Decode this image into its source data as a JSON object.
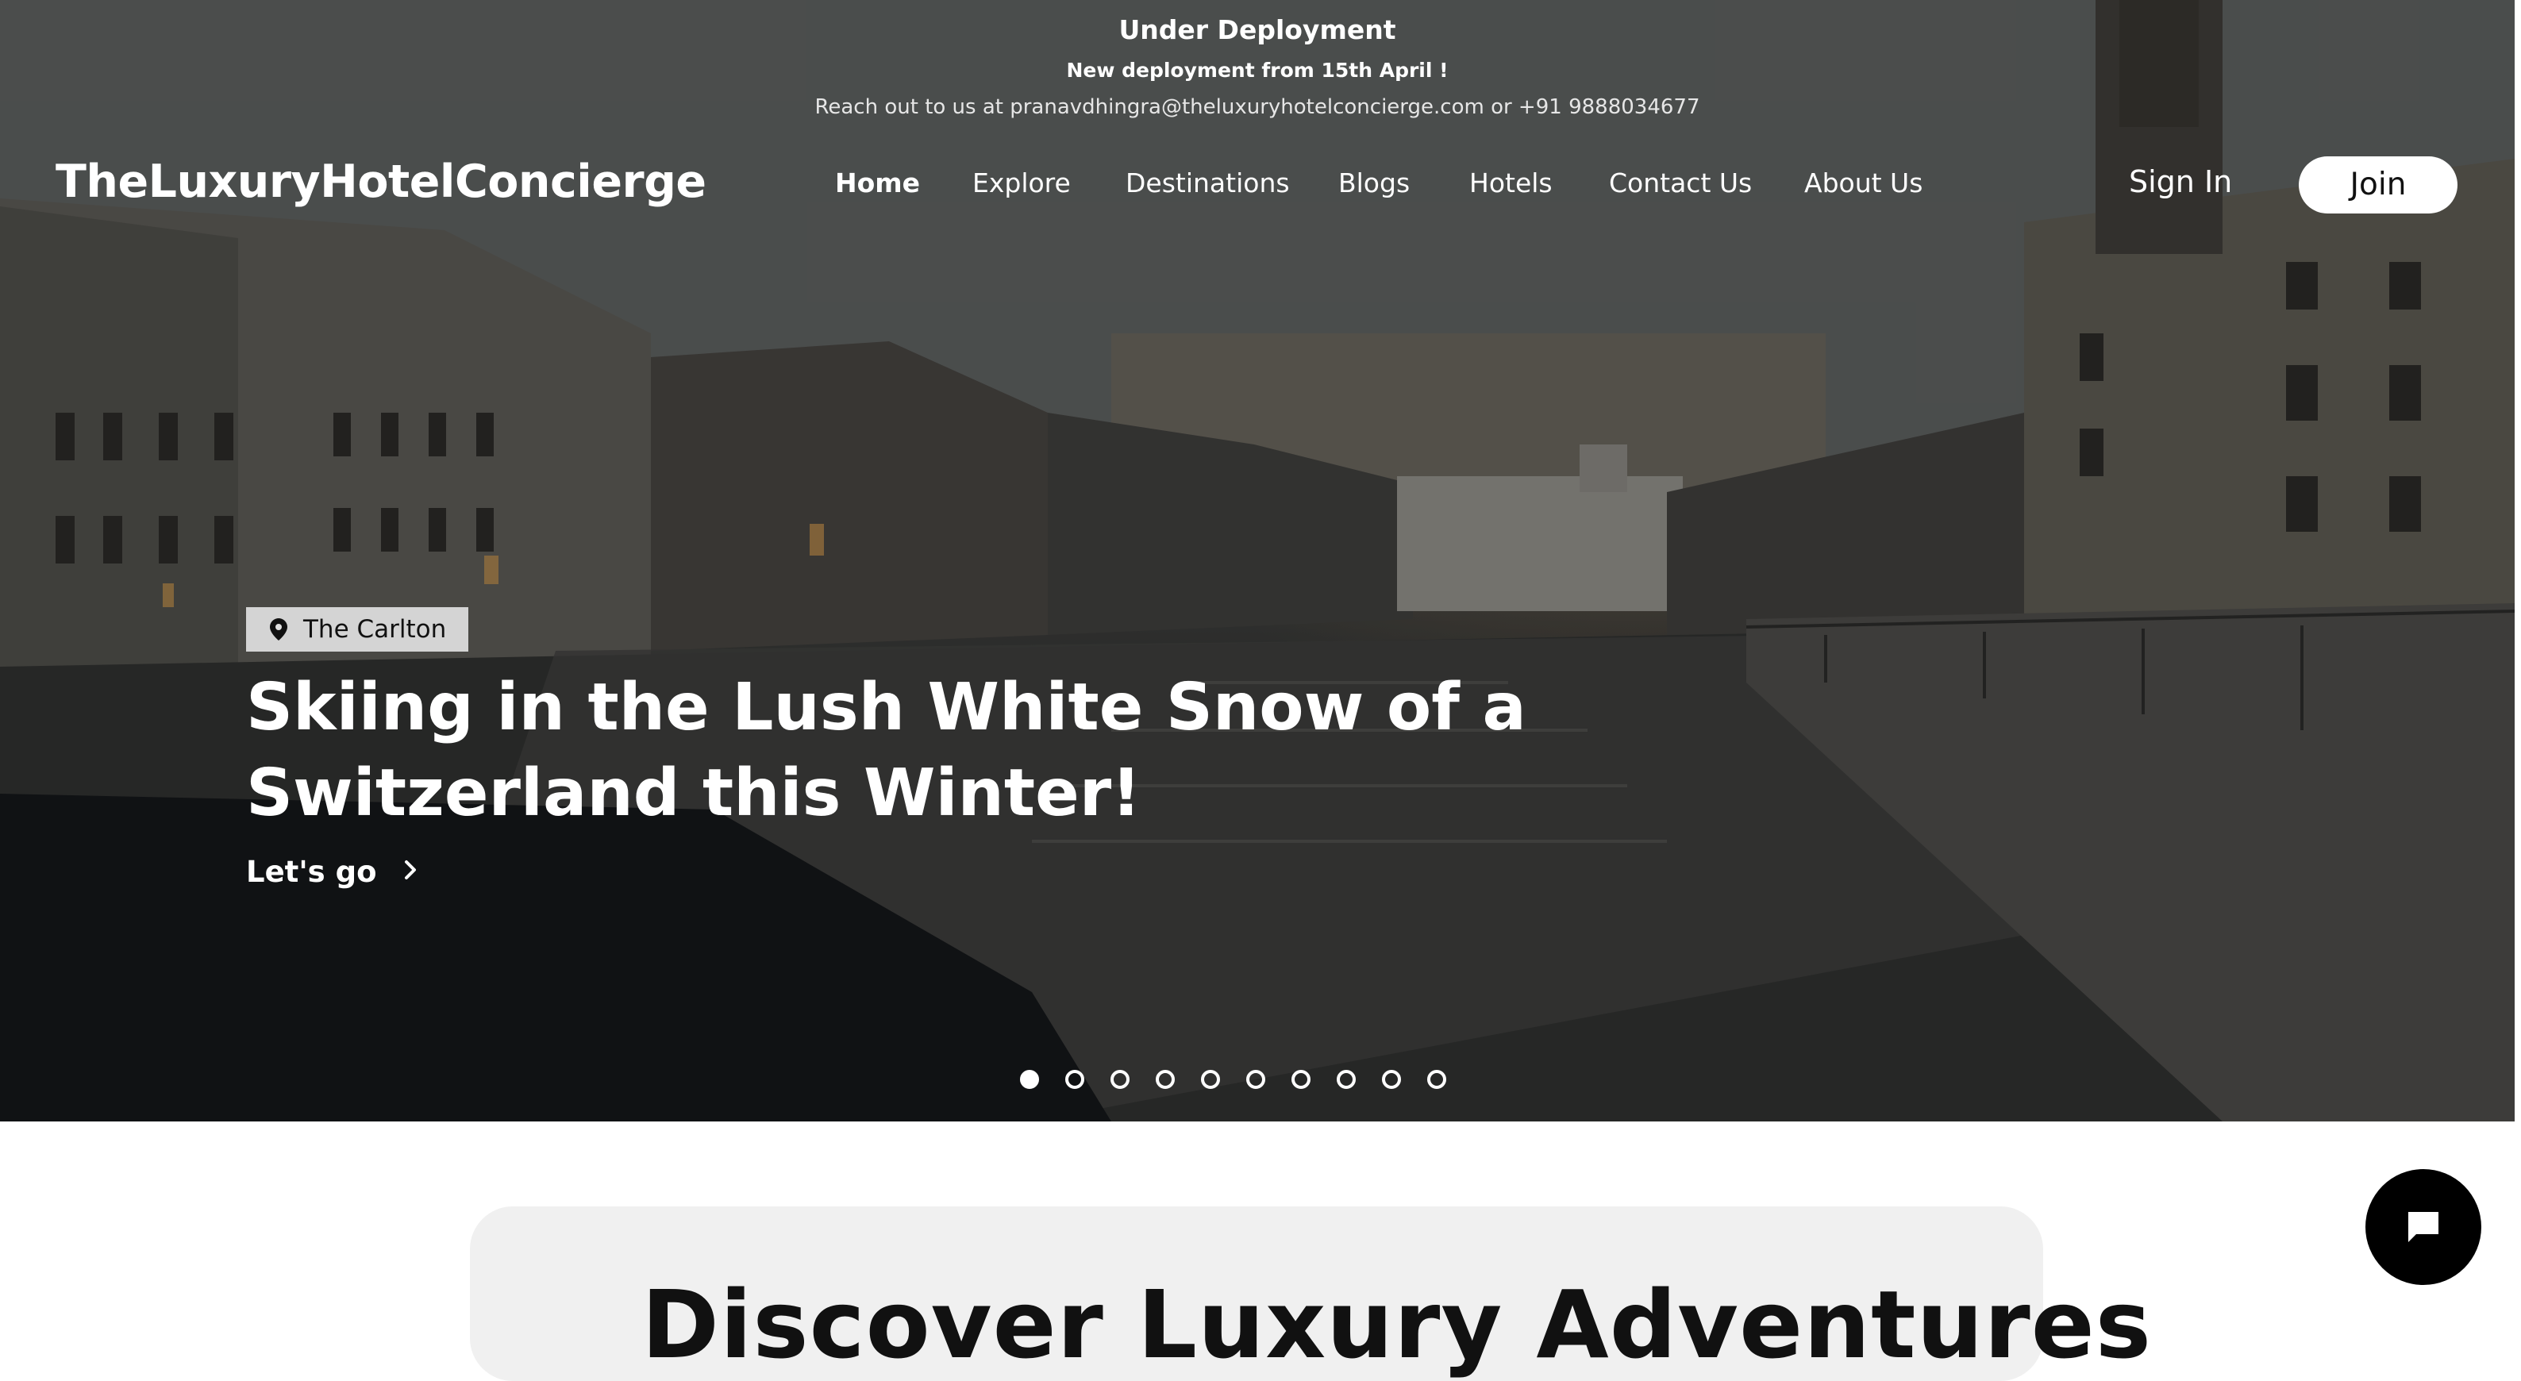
{
  "announcement": {
    "title": "Under Deployment",
    "subtitle": "New deployment from 15th April !",
    "contact": "Reach out to us at pranavdhingra@theluxuryhotelconcierge.com or +91 9888034677"
  },
  "header": {
    "logo": "TheLuxuryHotelConcierge",
    "nav": [
      "Home",
      "Explore",
      "Destinations",
      "Blogs",
      "Hotels",
      "Contact Us",
      "About Us"
    ],
    "active_nav": "Home",
    "sign_in": "Sign In",
    "join": "Join"
  },
  "hero": {
    "location_icon": "map-pin-icon",
    "location": "The Carlton",
    "headline": "Skiing in the Lush White Snow of a Switzerland this Winter!",
    "cta": "Let's go",
    "cta_icon": "chevron-right-icon",
    "slide_count": 10,
    "active_slide": 1
  },
  "section": {
    "title_partial": "Discover Luxury Adventures"
  },
  "chat": {
    "icon": "chat-bubble-icon"
  },
  "colors": {
    "hero_overlay": "#2b2c2b",
    "button_bg": "#ffffff",
    "card_bg": "#f0f0f0",
    "chat_bg": "#000000"
  }
}
